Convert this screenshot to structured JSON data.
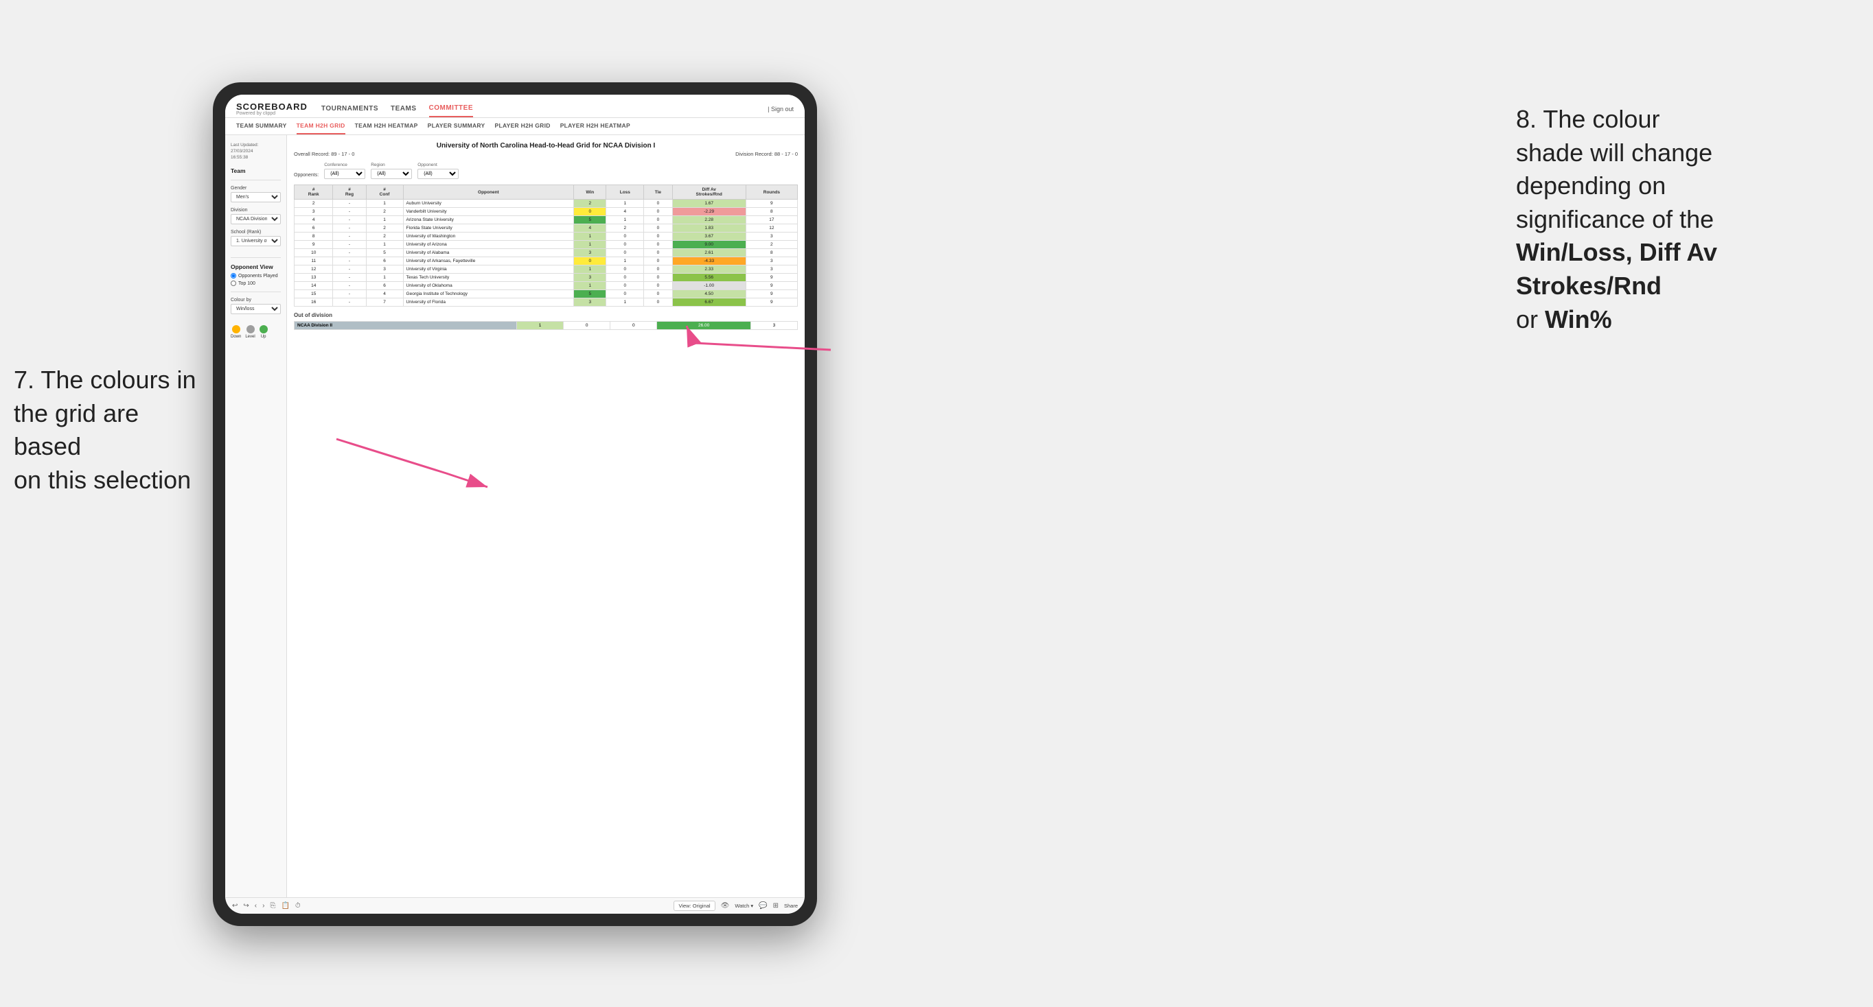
{
  "page": {
    "background": "#f0f0f0"
  },
  "app": {
    "logo": "SCOREBOARD",
    "logo_sub": "Powered by clippd",
    "nav": {
      "items": [
        "TOURNAMENTS",
        "TEAMS",
        "COMMITTEE"
      ],
      "active": "COMMITTEE",
      "sign_out": "Sign out"
    },
    "sub_nav": {
      "items": [
        "TEAM SUMMARY",
        "TEAM H2H GRID",
        "TEAM H2H HEATMAP",
        "PLAYER SUMMARY",
        "PLAYER H2H GRID",
        "PLAYER H2H HEATMAP"
      ],
      "active": "TEAM H2H GRID"
    }
  },
  "left_panel": {
    "last_updated_label": "Last Updated: 27/03/2024",
    "last_updated_time": "16:55:38",
    "team_label": "Team",
    "gender_label": "Gender",
    "gender_value": "Men's",
    "division_label": "Division",
    "division_value": "NCAA Division I",
    "school_label": "School (Rank)",
    "school_value": "1. University of Nort...",
    "opponent_view_label": "Opponent View",
    "radio_opponents": "Opponents Played",
    "radio_top100": "Top 100",
    "colour_by_label": "Colour by",
    "colour_by_value": "Win/loss",
    "legend": {
      "down_label": "Down",
      "level_label": "Level",
      "up_label": "Up",
      "down_color": "#ffb300",
      "level_color": "#9e9e9e",
      "up_color": "#4caf50"
    }
  },
  "grid": {
    "title": "University of North Carolina Head-to-Head Grid for NCAA Division I",
    "overall_record_label": "Overall Record:",
    "overall_record": "89 - 17 - 0",
    "division_record_label": "Division Record:",
    "division_record": "88 - 17 - 0",
    "filters": {
      "opponents_label": "Opponents:",
      "conference_label": "Conference",
      "conference_value": "(All)",
      "region_label": "Region",
      "region_value": "(All)",
      "opponent_label": "Opponent",
      "opponent_value": "(All)"
    },
    "columns": [
      "#\nRank",
      "#\nReg",
      "#\nConf",
      "Opponent",
      "Win",
      "Loss",
      "Tie",
      "Diff Av\nStrokes/Rnd",
      "Rounds"
    ],
    "rows": [
      {
        "rank": "2",
        "reg": "-",
        "conf": "1",
        "opponent": "Auburn University",
        "win": "2",
        "loss": "1",
        "tie": "0",
        "diff": "1.67",
        "rounds": "9",
        "win_color": "green-light",
        "diff_color": "green-light"
      },
      {
        "rank": "3",
        "reg": "-",
        "conf": "2",
        "opponent": "Vanderbilt University",
        "win": "0",
        "loss": "4",
        "tie": "0",
        "diff": "-2.29",
        "rounds": "8",
        "win_color": "yellow",
        "diff_color": "red-light"
      },
      {
        "rank": "4",
        "reg": "-",
        "conf": "1",
        "opponent": "Arizona State University",
        "win": "5",
        "loss": "1",
        "tie": "0",
        "diff": "2.28",
        "rounds": "17",
        "win_color": "green-dark",
        "diff_color": "green-light"
      },
      {
        "rank": "6",
        "reg": "-",
        "conf": "2",
        "opponent": "Florida State University",
        "win": "4",
        "loss": "2",
        "tie": "0",
        "diff": "1.83",
        "rounds": "12",
        "win_color": "green-light",
        "diff_color": "green-light"
      },
      {
        "rank": "8",
        "reg": "-",
        "conf": "2",
        "opponent": "University of Washington",
        "win": "1",
        "loss": "0",
        "tie": "0",
        "diff": "3.67",
        "rounds": "3",
        "win_color": "green-light",
        "diff_color": "green-light"
      },
      {
        "rank": "9",
        "reg": "-",
        "conf": "1",
        "opponent": "University of Arizona",
        "win": "1",
        "loss": "0",
        "tie": "0",
        "diff": "9.00",
        "rounds": "2",
        "win_color": "green-light",
        "diff_color": "green-dark"
      },
      {
        "rank": "10",
        "reg": "-",
        "conf": "5",
        "opponent": "University of Alabama",
        "win": "3",
        "loss": "0",
        "tie": "0",
        "diff": "2.61",
        "rounds": "8",
        "win_color": "green-light",
        "diff_color": "green-light"
      },
      {
        "rank": "11",
        "reg": "-",
        "conf": "6",
        "opponent": "University of Arkansas, Fayetteville",
        "win": "0",
        "loss": "1",
        "tie": "0",
        "diff": "-4.33",
        "rounds": "3",
        "win_color": "yellow",
        "diff_color": "orange"
      },
      {
        "rank": "12",
        "reg": "-",
        "conf": "3",
        "opponent": "University of Virginia",
        "win": "1",
        "loss": "0",
        "tie": "0",
        "diff": "2.33",
        "rounds": "3",
        "win_color": "green-light",
        "diff_color": "green-light"
      },
      {
        "rank": "13",
        "reg": "-",
        "conf": "1",
        "opponent": "Texas Tech University",
        "win": "3",
        "loss": "0",
        "tie": "0",
        "diff": "5.56",
        "rounds": "9",
        "win_color": "green-light",
        "diff_color": "green-med"
      },
      {
        "rank": "14",
        "reg": "-",
        "conf": "6",
        "opponent": "University of Oklahoma",
        "win": "1",
        "loss": "0",
        "tie": "0",
        "diff": "-1.00",
        "rounds": "9",
        "win_color": "green-light",
        "diff_color": "gray"
      },
      {
        "rank": "15",
        "reg": "-",
        "conf": "4",
        "opponent": "Georgia Institute of Technology",
        "win": "5",
        "loss": "0",
        "tie": "0",
        "diff": "4.50",
        "rounds": "9",
        "win_color": "green-dark",
        "diff_color": "green-light"
      },
      {
        "rank": "16",
        "reg": "-",
        "conf": "7",
        "opponent": "University of Florida",
        "win": "3",
        "loss": "1",
        "tie": "0",
        "diff": "6.67",
        "rounds": "9",
        "win_color": "green-light",
        "diff_color": "green-med"
      }
    ],
    "out_of_division_label": "Out of division",
    "out_of_division_row": {
      "name": "NCAA Division II",
      "win": "1",
      "loss": "0",
      "tie": "0",
      "diff": "26.00",
      "rounds": "3"
    }
  },
  "toolbar": {
    "view_label": "View: Original",
    "watch_label": "Watch ▾",
    "share_label": "Share"
  },
  "annotations": {
    "right_text_parts": [
      "8. The colour",
      "shade will change",
      "depending on",
      "significance of the"
    ],
    "right_bold": "Win/Loss, Diff Av Strokes/Rnd",
    "right_suffix": " or ",
    "right_bold2": "Win%",
    "left_text": "7. The colours in the grid are based on this selection"
  }
}
